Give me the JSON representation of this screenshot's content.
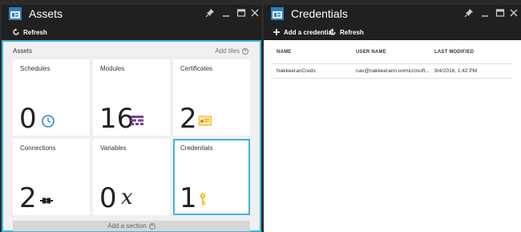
{
  "assets_blade": {
    "title": "Assets",
    "refresh_label": "Refresh",
    "section_label": "Assets",
    "add_tiles_label": "Add tiles",
    "add_section_label": "Add a section",
    "tiles": [
      {
        "label": "Schedules",
        "count": "0",
        "icon": "clock-icon"
      },
      {
        "label": "Modules",
        "count": "16",
        "icon": "modules-grid-icon"
      },
      {
        "label": "Certificates",
        "count": "2",
        "icon": "certificate-icon"
      },
      {
        "label": "Connections",
        "count": "2",
        "icon": "connection-plug-icon"
      },
      {
        "label": "Variables",
        "count": "0",
        "icon": "variable-x-icon",
        "symbol": "x"
      },
      {
        "label": "Credentials",
        "count": "1",
        "icon": "key-icon"
      }
    ]
  },
  "credentials_blade": {
    "title": "Credentials",
    "add_label": "Add a credential",
    "refresh_label": "Refresh",
    "columns": [
      "NAME",
      "USER NAME",
      "LAST MODIFIED"
    ],
    "rows": [
      {
        "name": "NakkeeranCreds",
        "user": "nav@nakkeerann.onmicrosoft...",
        "modified": "9/4/2016, 1:42 PM"
      }
    ]
  },
  "colors": {
    "accent": "#3ab7dc",
    "header_bg": "#202020",
    "clock_blue": "#2f87c6",
    "modules_purple": "#7a3f96",
    "certificate_yellow": "#f2c32f",
    "key_yellow": "#f2c32f"
  }
}
